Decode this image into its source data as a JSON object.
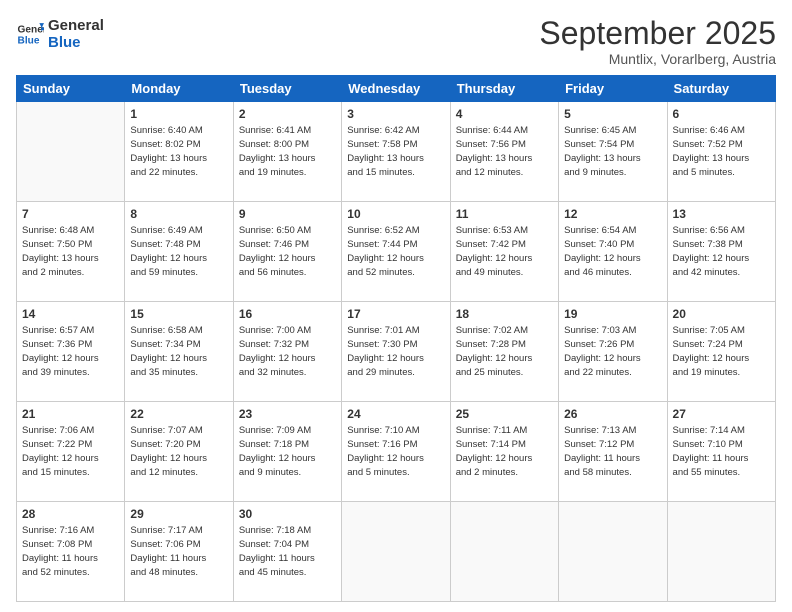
{
  "header": {
    "logo_general": "General",
    "logo_blue": "Blue",
    "month": "September 2025",
    "location": "Muntlix, Vorarlberg, Austria"
  },
  "days_of_week": [
    "Sunday",
    "Monday",
    "Tuesday",
    "Wednesday",
    "Thursday",
    "Friday",
    "Saturday"
  ],
  "weeks": [
    [
      {
        "day": "",
        "info": ""
      },
      {
        "day": "1",
        "info": "Sunrise: 6:40 AM\nSunset: 8:02 PM\nDaylight: 13 hours\nand 22 minutes."
      },
      {
        "day": "2",
        "info": "Sunrise: 6:41 AM\nSunset: 8:00 PM\nDaylight: 13 hours\nand 19 minutes."
      },
      {
        "day": "3",
        "info": "Sunrise: 6:42 AM\nSunset: 7:58 PM\nDaylight: 13 hours\nand 15 minutes."
      },
      {
        "day": "4",
        "info": "Sunrise: 6:44 AM\nSunset: 7:56 PM\nDaylight: 13 hours\nand 12 minutes."
      },
      {
        "day": "5",
        "info": "Sunrise: 6:45 AM\nSunset: 7:54 PM\nDaylight: 13 hours\nand 9 minutes."
      },
      {
        "day": "6",
        "info": "Sunrise: 6:46 AM\nSunset: 7:52 PM\nDaylight: 13 hours\nand 5 minutes."
      }
    ],
    [
      {
        "day": "7",
        "info": "Sunrise: 6:48 AM\nSunset: 7:50 PM\nDaylight: 13 hours\nand 2 minutes."
      },
      {
        "day": "8",
        "info": "Sunrise: 6:49 AM\nSunset: 7:48 PM\nDaylight: 12 hours\nand 59 minutes."
      },
      {
        "day": "9",
        "info": "Sunrise: 6:50 AM\nSunset: 7:46 PM\nDaylight: 12 hours\nand 56 minutes."
      },
      {
        "day": "10",
        "info": "Sunrise: 6:52 AM\nSunset: 7:44 PM\nDaylight: 12 hours\nand 52 minutes."
      },
      {
        "day": "11",
        "info": "Sunrise: 6:53 AM\nSunset: 7:42 PM\nDaylight: 12 hours\nand 49 minutes."
      },
      {
        "day": "12",
        "info": "Sunrise: 6:54 AM\nSunset: 7:40 PM\nDaylight: 12 hours\nand 46 minutes."
      },
      {
        "day": "13",
        "info": "Sunrise: 6:56 AM\nSunset: 7:38 PM\nDaylight: 12 hours\nand 42 minutes."
      }
    ],
    [
      {
        "day": "14",
        "info": "Sunrise: 6:57 AM\nSunset: 7:36 PM\nDaylight: 12 hours\nand 39 minutes."
      },
      {
        "day": "15",
        "info": "Sunrise: 6:58 AM\nSunset: 7:34 PM\nDaylight: 12 hours\nand 35 minutes."
      },
      {
        "day": "16",
        "info": "Sunrise: 7:00 AM\nSunset: 7:32 PM\nDaylight: 12 hours\nand 32 minutes."
      },
      {
        "day": "17",
        "info": "Sunrise: 7:01 AM\nSunset: 7:30 PM\nDaylight: 12 hours\nand 29 minutes."
      },
      {
        "day": "18",
        "info": "Sunrise: 7:02 AM\nSunset: 7:28 PM\nDaylight: 12 hours\nand 25 minutes."
      },
      {
        "day": "19",
        "info": "Sunrise: 7:03 AM\nSunset: 7:26 PM\nDaylight: 12 hours\nand 22 minutes."
      },
      {
        "day": "20",
        "info": "Sunrise: 7:05 AM\nSunset: 7:24 PM\nDaylight: 12 hours\nand 19 minutes."
      }
    ],
    [
      {
        "day": "21",
        "info": "Sunrise: 7:06 AM\nSunset: 7:22 PM\nDaylight: 12 hours\nand 15 minutes."
      },
      {
        "day": "22",
        "info": "Sunrise: 7:07 AM\nSunset: 7:20 PM\nDaylight: 12 hours\nand 12 minutes."
      },
      {
        "day": "23",
        "info": "Sunrise: 7:09 AM\nSunset: 7:18 PM\nDaylight: 12 hours\nand 9 minutes."
      },
      {
        "day": "24",
        "info": "Sunrise: 7:10 AM\nSunset: 7:16 PM\nDaylight: 12 hours\nand 5 minutes."
      },
      {
        "day": "25",
        "info": "Sunrise: 7:11 AM\nSunset: 7:14 PM\nDaylight: 12 hours\nand 2 minutes."
      },
      {
        "day": "26",
        "info": "Sunrise: 7:13 AM\nSunset: 7:12 PM\nDaylight: 11 hours\nand 58 minutes."
      },
      {
        "day": "27",
        "info": "Sunrise: 7:14 AM\nSunset: 7:10 PM\nDaylight: 11 hours\nand 55 minutes."
      }
    ],
    [
      {
        "day": "28",
        "info": "Sunrise: 7:16 AM\nSunset: 7:08 PM\nDaylight: 11 hours\nand 52 minutes."
      },
      {
        "day": "29",
        "info": "Sunrise: 7:17 AM\nSunset: 7:06 PM\nDaylight: 11 hours\nand 48 minutes."
      },
      {
        "day": "30",
        "info": "Sunrise: 7:18 AM\nSunset: 7:04 PM\nDaylight: 11 hours\nand 45 minutes."
      },
      {
        "day": "",
        "info": ""
      },
      {
        "day": "",
        "info": ""
      },
      {
        "day": "",
        "info": ""
      },
      {
        "day": "",
        "info": ""
      }
    ]
  ]
}
